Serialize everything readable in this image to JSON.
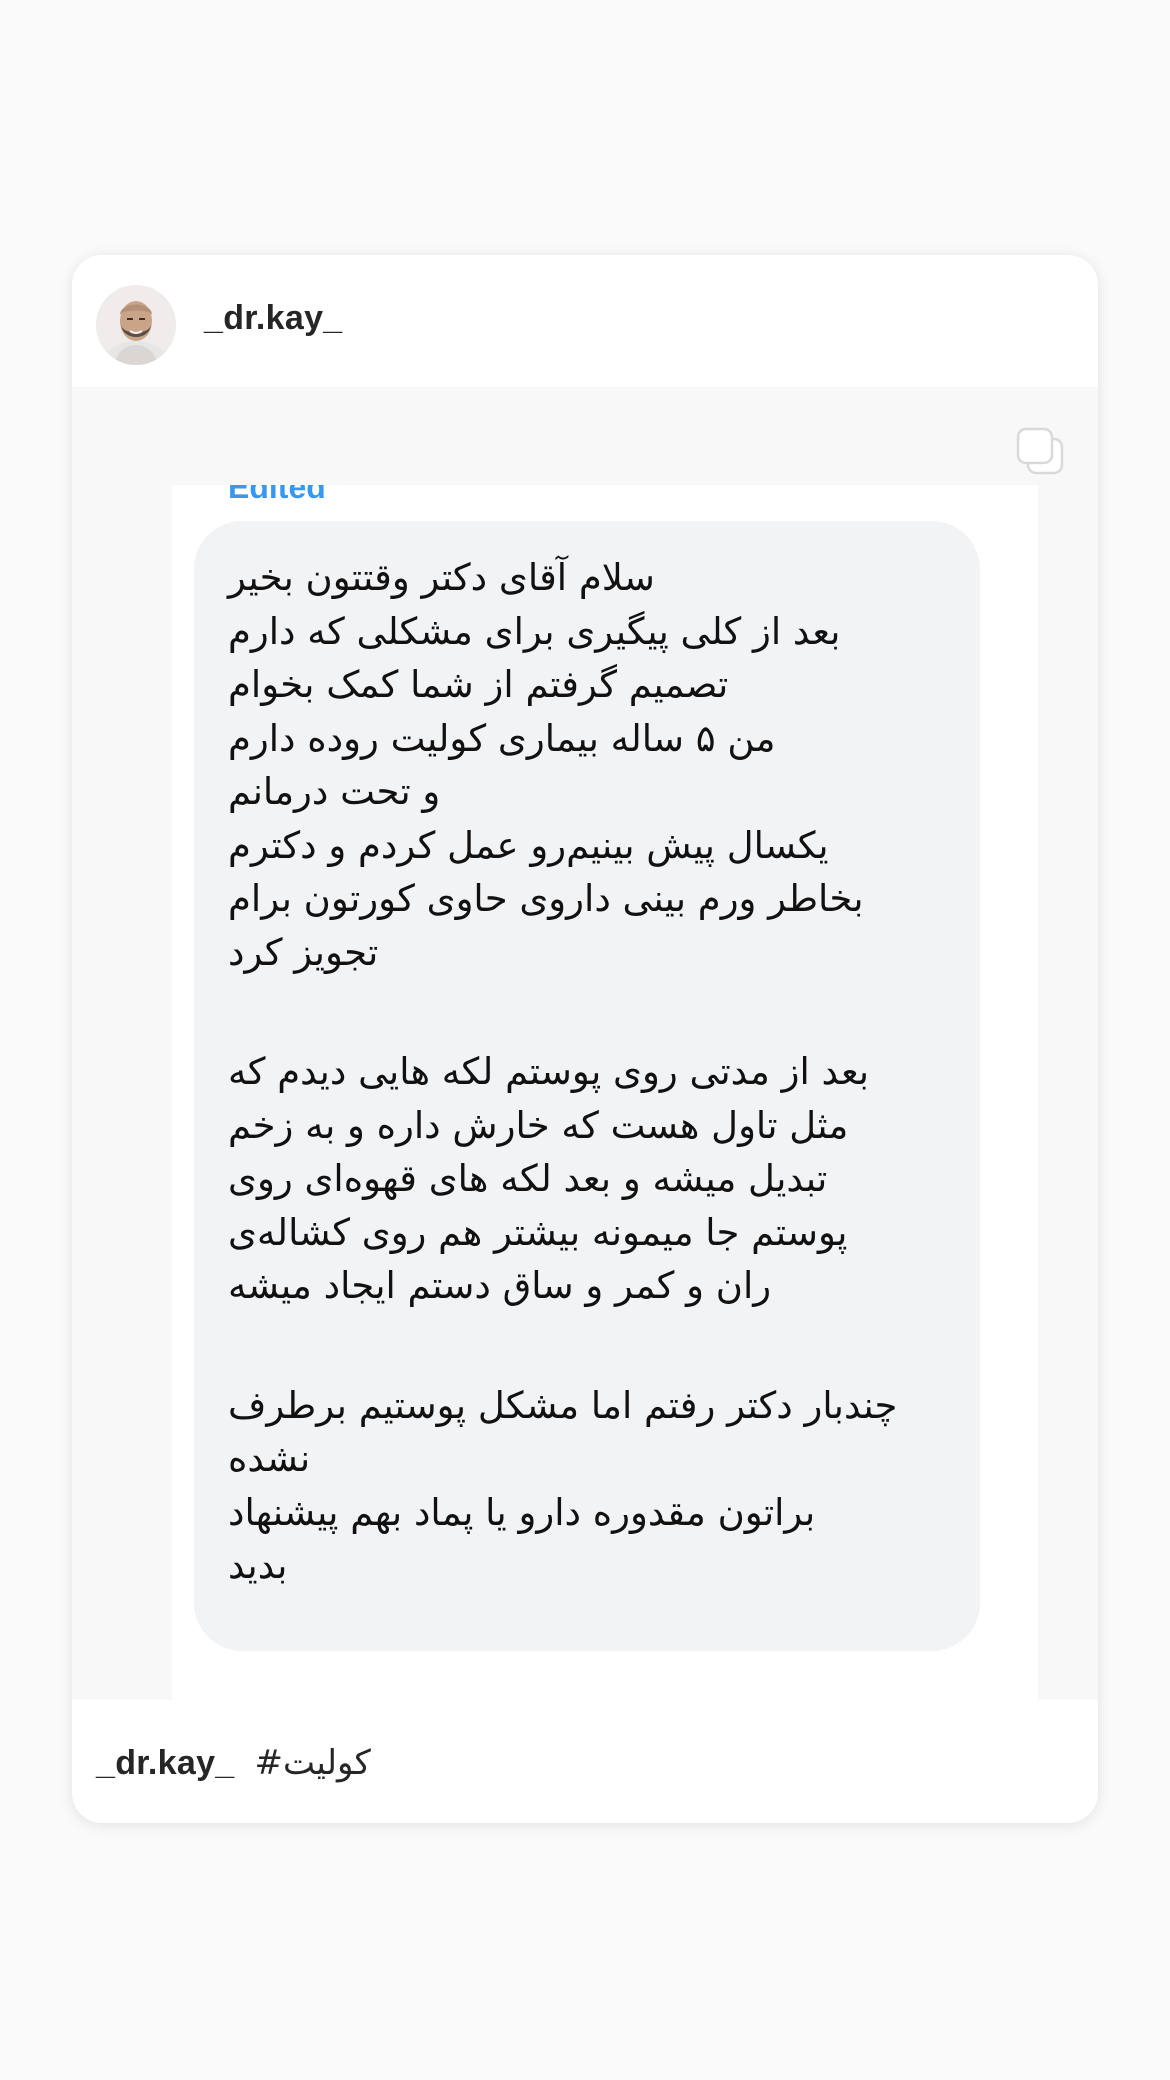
{
  "post": {
    "username": "_dr.kay_",
    "avatar_icon": "profile-photo",
    "multi_icon": "carousel-icon",
    "edited_label": "Edited",
    "message_lines": [
      "سلام آقای دکتر وقتتون بخیر",
      "بعد از کلی پیگیری برای مشکلی که دارم",
      "تصمیم گرفتم از شما کمک بخوام",
      "من ۵ ساله بیماری کولیت روده دارم",
      "و تحت درمانم",
      "یکسال پیش بینیم‌رو عمل کردم و دکترم",
      "بخاطر ورم بینی داروی حاوی کورتون برام",
      "تجویز کرد",
      "",
      "بعد از مدتی روی پوستم لکه هایی دیدم که",
      "مثل تاول هست که خارش داره و به زخم",
      "تبدیل میشه و بعد لکه های قهوه‌ای روی",
      "پوستم جا میمونه بیشتر هم روی کشاله‌ی",
      "ران و کمر و ساق دستم ایجاد میشه",
      "",
      "چندبار دکتر رفتم اما مشکل پوستیم برطرف",
      "نشده",
      "براتون مقدوره دارو یا پماد بهم پیشنهاد",
      "بدید"
    ],
    "caption_user": "_dr.kay_",
    "caption_text": "#کولیت",
    "colors": {
      "edited": "#3897f0",
      "bubble": "#f2f3f5",
      "background": "#fafafa"
    }
  }
}
